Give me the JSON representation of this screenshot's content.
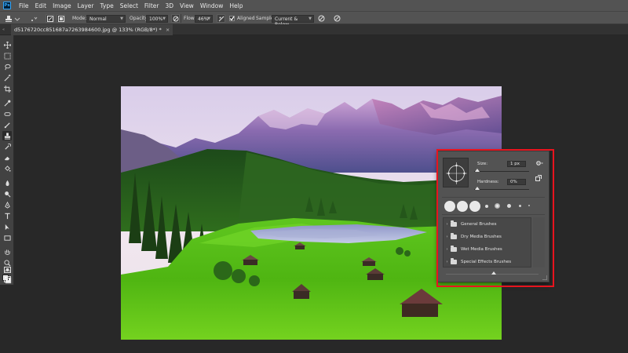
{
  "app": {
    "logo_text": "Ps"
  },
  "menu": [
    "File",
    "Edit",
    "Image",
    "Layer",
    "Type",
    "Select",
    "Filter",
    "3D",
    "View",
    "Window",
    "Help"
  ],
  "options_bar": {
    "mode_label": "Mode:",
    "mode_value": "Normal",
    "opacity_label": "Opacity:",
    "opacity_value": "100%",
    "flow_label": "Flow:",
    "flow_value": "46%",
    "aligned_label": "Aligned",
    "aligned_checked": true,
    "sample_label": "Sample:",
    "sample_value": "Current & Below"
  },
  "document_tab": {
    "title": "d5176720cc851687a7263984600.jpg @ 133% (RGB/8*) *",
    "close_glyph": "×",
    "collapse_glyph": "«"
  },
  "tools": [
    "move-tool",
    "marquee-tool",
    "lasso-tool",
    "magic-wand-tool",
    "crop-tool",
    "eyedropper-tool",
    "healing-brush-tool",
    "brush-tool",
    "clone-stamp-tool",
    "history-brush-tool",
    "eraser-tool",
    "paint-bucket-tool",
    "blur-tool",
    "dodge-tool",
    "pen-tool",
    "type-tool",
    "path-selection-tool",
    "rectangle-tool",
    "hand-tool",
    "zoom-tool",
    "edit-toolbar",
    "color-swatches",
    "quick-mask",
    "screen-mode"
  ],
  "active_tool": "clone-stamp-tool",
  "brush_panel": {
    "size_label": "Size:",
    "size_value": "1 px",
    "hardness_label": "Hardness:",
    "hardness_value": "0%",
    "gear_icon": "gear-icon",
    "folders": [
      "General Brushes",
      "Dry Media Brushes",
      "Wet Media Brushes",
      "Special Effects Brushes"
    ]
  },
  "colors": {
    "highlight": "#e8141e",
    "ui_dark": "#282828",
    "panel": "#535353",
    "accent": "#31a8ff"
  }
}
